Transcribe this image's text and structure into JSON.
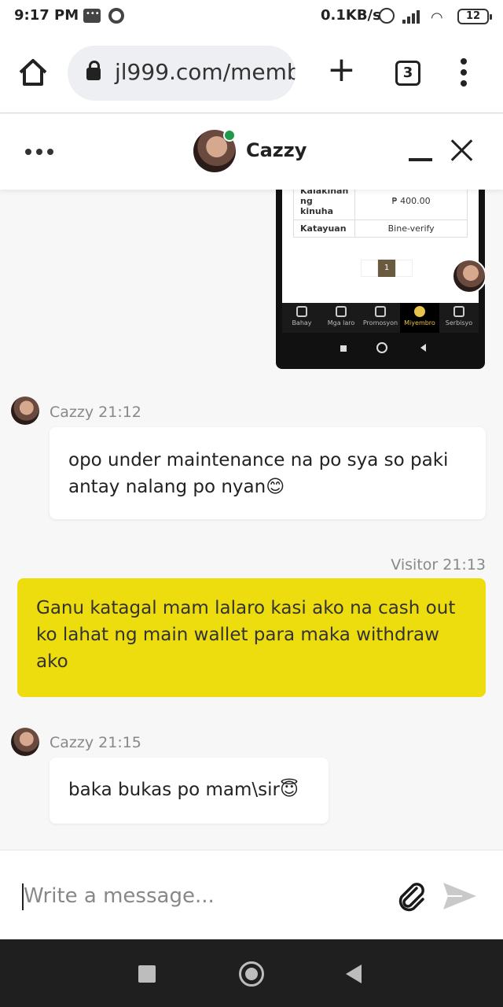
{
  "status_bar": {
    "time": "9:17 PM",
    "net_speed": "0.1KB/s",
    "battery": "12",
    "icons": [
      "message-icon",
      "chrome-icon",
      "alarm-icon",
      "signal-icon",
      "wifi-icon",
      "battery-icon"
    ]
  },
  "browser": {
    "url": "jl999.com/memb",
    "tab_count": "3",
    "icons": [
      "home-icon",
      "lock-icon",
      "plus-icon",
      "tabs-icon",
      "menu-icon"
    ]
  },
  "chat_header": {
    "agent_name": "Cazzy",
    "online_color": "#1f9a4a",
    "icons": [
      "more-icon",
      "minimize-icon",
      "close-icon"
    ]
  },
  "embedded_screenshot": {
    "table": [
      {
        "label": "Kalakihan ng kinuha",
        "value": "₱ 400.00"
      },
      {
        "label": "Katayuan",
        "value": "Bine-verify"
      }
    ],
    "page": "1",
    "nav": [
      "Bahay",
      "Mga laro",
      "Promosyon",
      "Miyembro",
      "Serbisyo"
    ],
    "active_nav": "Miyembro"
  },
  "messages": [
    {
      "sender": "Cazzy",
      "time": "21:12",
      "meta": "Cazzy 21:12",
      "lines": [
        "opo under maintenance na po sya so paki",
        "antay nalang po nyan😊"
      ]
    },
    {
      "sender": "Visitor",
      "time": "21:13",
      "meta": "Visitor 21:13",
      "lines": [
        "Ganu katagal mam lalaro kasi ako na cash out",
        "ko lahat ng main wallet para maka withdraw",
        "ako"
      ]
    },
    {
      "sender": "Cazzy",
      "time": "21:15",
      "meta": "Cazzy 21:15",
      "lines": [
        "baka bukas po mam\\sir😇"
      ]
    }
  ],
  "input": {
    "placeholder": "Write a message...",
    "value": ""
  },
  "colors": {
    "visitor_bubble": "#eedd0e",
    "agent_bubble": "#ffffff",
    "chat_bg": "#f7f7f7"
  }
}
